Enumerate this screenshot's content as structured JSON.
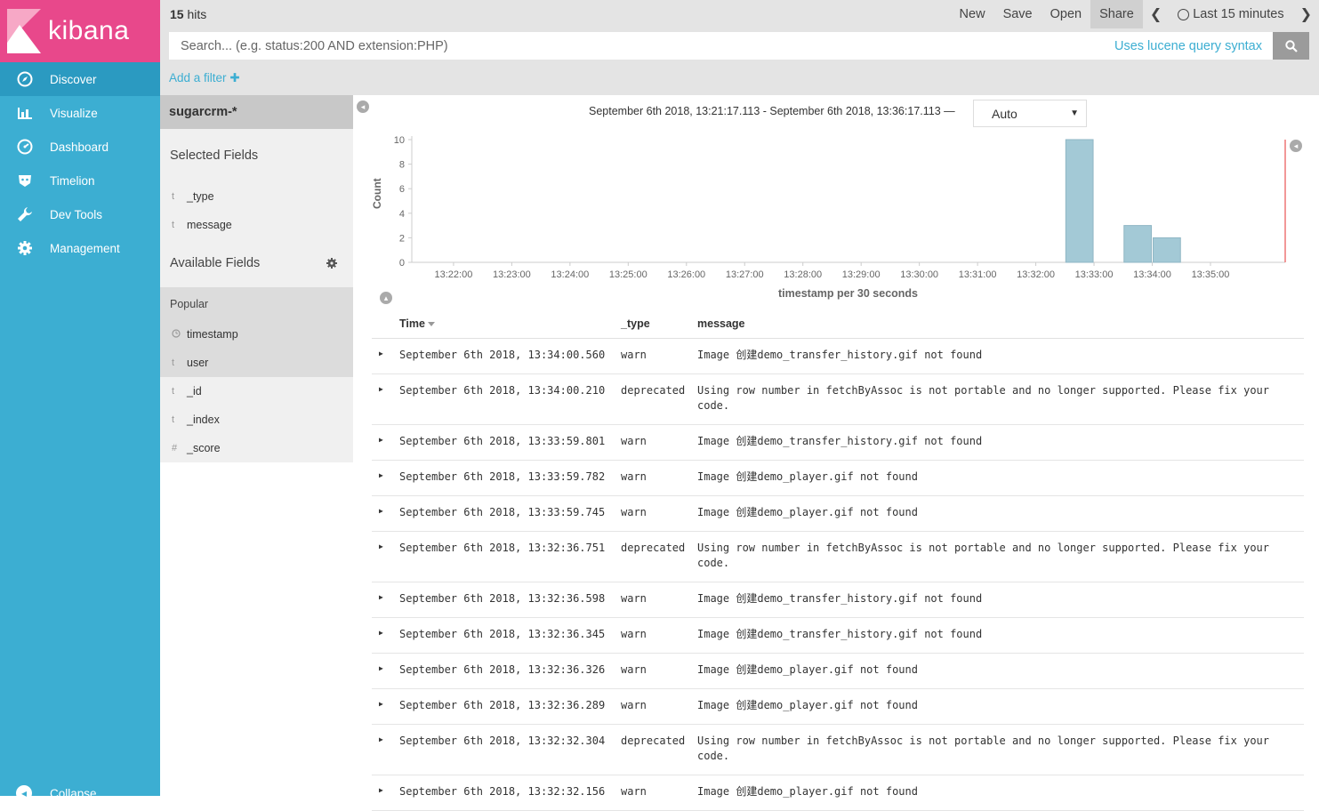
{
  "app": {
    "brand": "kibana"
  },
  "nav": [
    {
      "label": "Discover",
      "icon": "compass-icon"
    },
    {
      "label": "Visualize",
      "icon": "bar-chart-icon"
    },
    {
      "label": "Dashboard",
      "icon": "dashboard-icon"
    },
    {
      "label": "Timelion",
      "icon": "timelion-icon"
    },
    {
      "label": "Dev Tools",
      "icon": "wrench-icon"
    },
    {
      "label": "Management",
      "icon": "gear-icon"
    }
  ],
  "collapse_label": "Collapse",
  "header": {
    "hits_count": "15",
    "hits_label": "hits",
    "menu": {
      "new": "New",
      "save": "Save",
      "open": "Open",
      "share": "Share",
      "timerange": "Last 15 minutes"
    }
  },
  "search": {
    "placeholder": "Search... (e.g. status:200 AND extension:PHP)",
    "value": "",
    "lucene_label": "Uses lucene query syntax"
  },
  "add_filter_label": "Add a filter",
  "fields": {
    "index_pattern": "sugarcrm-*",
    "selected_title": "Selected Fields",
    "selected": [
      {
        "type": "t",
        "name": "_type"
      },
      {
        "type": "t",
        "name": "message"
      }
    ],
    "available_title": "Available Fields",
    "popular_title": "Popular",
    "popular": [
      {
        "type": "clock",
        "name": "timestamp"
      },
      {
        "type": "t",
        "name": "user"
      }
    ],
    "others": [
      {
        "type": "t",
        "name": "_id"
      },
      {
        "type": "t",
        "name": "_index"
      },
      {
        "type": "#",
        "name": "_score"
      }
    ]
  },
  "histogram": {
    "date_range": "September 6th 2018, 13:21:17.113 - September 6th 2018, 13:36:17.113 —",
    "interval": "Auto"
  },
  "chart_data": {
    "type": "bar",
    "xlabel": "timestamp per 30 seconds",
    "ylabel": "Count",
    "ylim": [
      0,
      10
    ],
    "yticks": [
      "0",
      "2",
      "4",
      "6",
      "8",
      "10"
    ],
    "xticks": [
      "13:22:00",
      "13:23:00",
      "13:24:00",
      "13:25:00",
      "13:26:00",
      "13:27:00",
      "13:28:00",
      "13:29:00",
      "13:30:00",
      "13:31:00",
      "13:32:00",
      "13:33:00",
      "13:34:00",
      "13:35:00"
    ],
    "bars": [
      {
        "x": "13:32:30",
        "value": 10
      },
      {
        "x": "13:33:30",
        "value": 3
      },
      {
        "x": "13:34:00",
        "value": 2
      }
    ],
    "grid": false,
    "bar_color": "#a3c9d6"
  },
  "table": {
    "headers": {
      "time": "Time",
      "type": "_type",
      "message": "message"
    },
    "rows": [
      {
        "time": "September 6th 2018, 13:34:00.560",
        "type": "warn",
        "message": "Image 创建demo_transfer_history.gif not found"
      },
      {
        "time": "September 6th 2018, 13:34:00.210",
        "type": "deprecated",
        "message": "Using row number in fetchByAssoc is not portable and no longer supported. Please fix your code."
      },
      {
        "time": "September 6th 2018, 13:33:59.801",
        "type": "warn",
        "message": "Image 创建demo_transfer_history.gif not found"
      },
      {
        "time": "September 6th 2018, 13:33:59.782",
        "type": "warn",
        "message": "Image 创建demo_player.gif not found"
      },
      {
        "time": "September 6th 2018, 13:33:59.745",
        "type": "warn",
        "message": "Image 创建demo_player.gif not found"
      },
      {
        "time": "September 6th 2018, 13:32:36.751",
        "type": "deprecated",
        "message": "Using row number in fetchByAssoc is not portable and no longer supported. Please fix your code."
      },
      {
        "time": "September 6th 2018, 13:32:36.598",
        "type": "warn",
        "message": "Image 创建demo_transfer_history.gif not found"
      },
      {
        "time": "September 6th 2018, 13:32:36.345",
        "type": "warn",
        "message": "Image 创建demo_transfer_history.gif not found"
      },
      {
        "time": "September 6th 2018, 13:32:36.326",
        "type": "warn",
        "message": "Image 创建demo_player.gif not found"
      },
      {
        "time": "September 6th 2018, 13:32:36.289",
        "type": "warn",
        "message": "Image 创建demo_player.gif not found"
      },
      {
        "time": "September 6th 2018, 13:32:32.304",
        "type": "deprecated",
        "message": "Using row number in fetchByAssoc is not portable and no longer supported. Please fix your code."
      },
      {
        "time": "September 6th 2018, 13:32:32.156",
        "type": "warn",
        "message": "Image 创建demo_player.gif not found"
      }
    ]
  },
  "colors": {
    "sidebar": "#3caed2",
    "logo_bg": "#e8488b",
    "accent": "#3caed2"
  }
}
